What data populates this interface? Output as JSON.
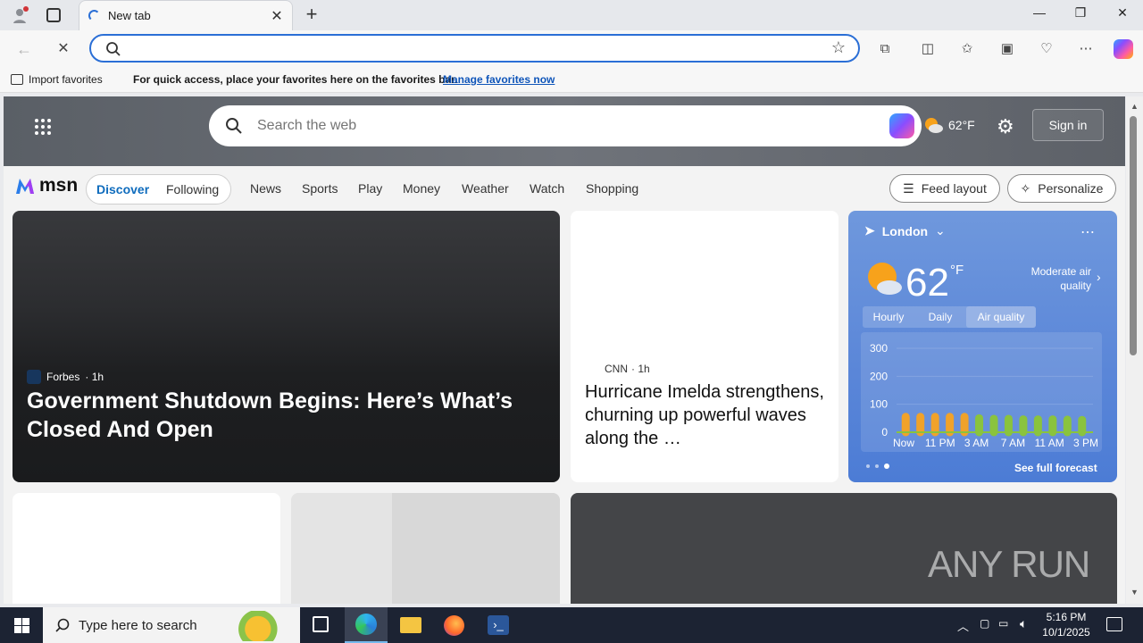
{
  "browser": {
    "tab_title": "New tab",
    "new_tab": "+",
    "window_controls": {
      "minimize": "—",
      "restore": "❐",
      "close": "✕"
    },
    "address_value": ""
  },
  "favorites_bar": {
    "import_label": "Import favorites",
    "message": "For quick access, place your favorites here on the favorites bar.",
    "manage_link": "Manage favorites now"
  },
  "msn": {
    "search_placeholder": "Search the web",
    "temp_small": "62°F",
    "sign_in": "Sign in",
    "logo": "msn",
    "tabs": [
      "Discover",
      "Following"
    ],
    "nav": [
      "News",
      "Sports",
      "Play",
      "Money",
      "Weather",
      "Watch",
      "Shopping"
    ],
    "feed_layout": "Feed layout",
    "personalize": "Personalize"
  },
  "main_story": {
    "source": "Forbes",
    "age": "· 1h",
    "headline": "Government Shutdown Begins: Here’s What’s Closed And Open"
  },
  "side_story": {
    "source": "CNN",
    "age": "· 1h",
    "headline": "Hurricane Imelda strengthens, churning up powerful waves along the …"
  },
  "weather": {
    "city": "London",
    "temp": "62",
    "unit": "°F",
    "aq_line1": "Moderate air",
    "aq_line2": "quality",
    "tabs": [
      "Hourly",
      "Daily",
      "Air quality"
    ],
    "y_ticks": [
      "300",
      "200",
      "100",
      "0"
    ],
    "x_labels": [
      "Now",
      "11 PM",
      "3 AM",
      "7 AM",
      "11 AM",
      "3 PM"
    ],
    "forecast_link": "See full forecast",
    "colors": {
      "moderate": "#f0a22a",
      "good": "#8ac33e"
    }
  },
  "chart_data": {
    "type": "bar",
    "title": "",
    "ylim": [
      0,
      300
    ],
    "y_ticks": [
      0,
      100,
      200,
      300
    ],
    "x_labels": [
      "Now",
      "11 PM",
      "3 AM",
      "7 AM",
      "11 AM",
      "3 PM"
    ],
    "values": [
      55,
      55,
      55,
      55,
      55,
      50,
      48,
      48,
      46,
      46,
      46,
      45,
      44
    ],
    "bar_colors": [
      "#f0a22a",
      "#f0a22a",
      "#f0a22a",
      "#f0a22a",
      "#f0a22a",
      "#8ac33e",
      "#8ac33e",
      "#8ac33e",
      "#8ac33e",
      "#8ac33e",
      "#8ac33e",
      "#8ac33e",
      "#8ac33e"
    ]
  },
  "watermark": "ANY RUN",
  "taskbar": {
    "search_placeholder": "Type here to search",
    "time": "5:16 PM",
    "date": "10/1/2025"
  }
}
